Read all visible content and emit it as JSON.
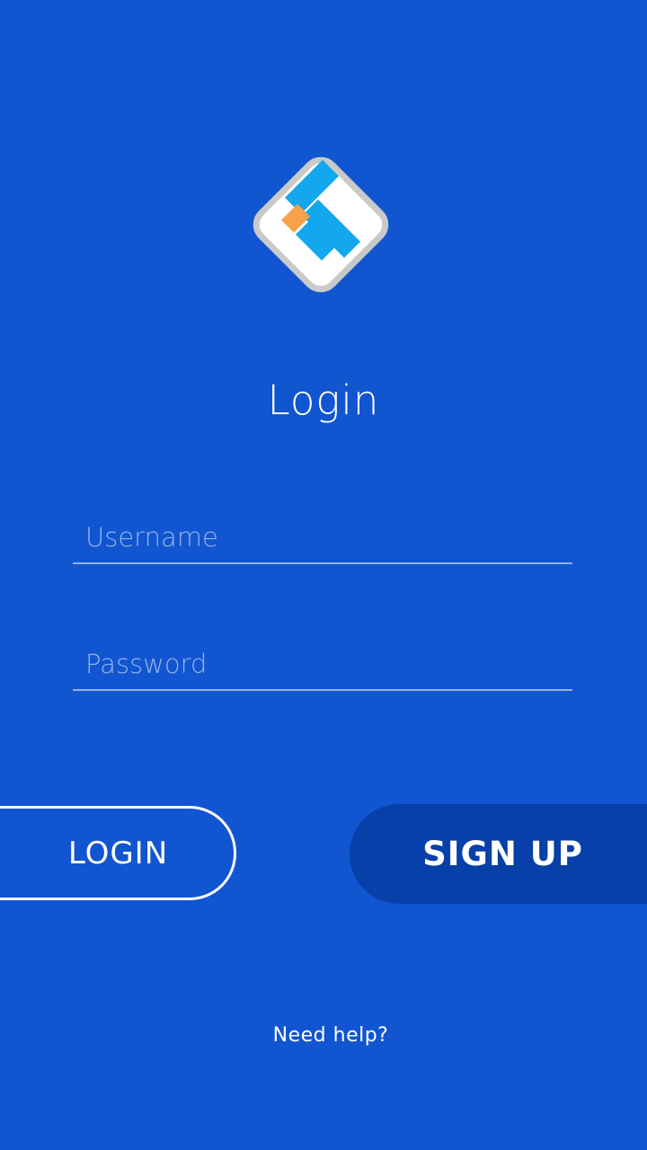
{
  "app": {
    "logo_icon": "app-logo-icon",
    "title": "Login"
  },
  "form": {
    "username_placeholder": "Username",
    "username_value": "",
    "password_placeholder": "Password",
    "password_value": ""
  },
  "buttons": {
    "login_label": "LOGIN",
    "signup_label": "SIGN UP"
  },
  "footer": {
    "help_link": "Need help?"
  },
  "colors": {
    "background": "#1155D0",
    "signup_button": "#0640A8",
    "logo_blue": "#12A7EE",
    "logo_orange": "#F7A24B",
    "logo_border": "#C9C9C9"
  }
}
